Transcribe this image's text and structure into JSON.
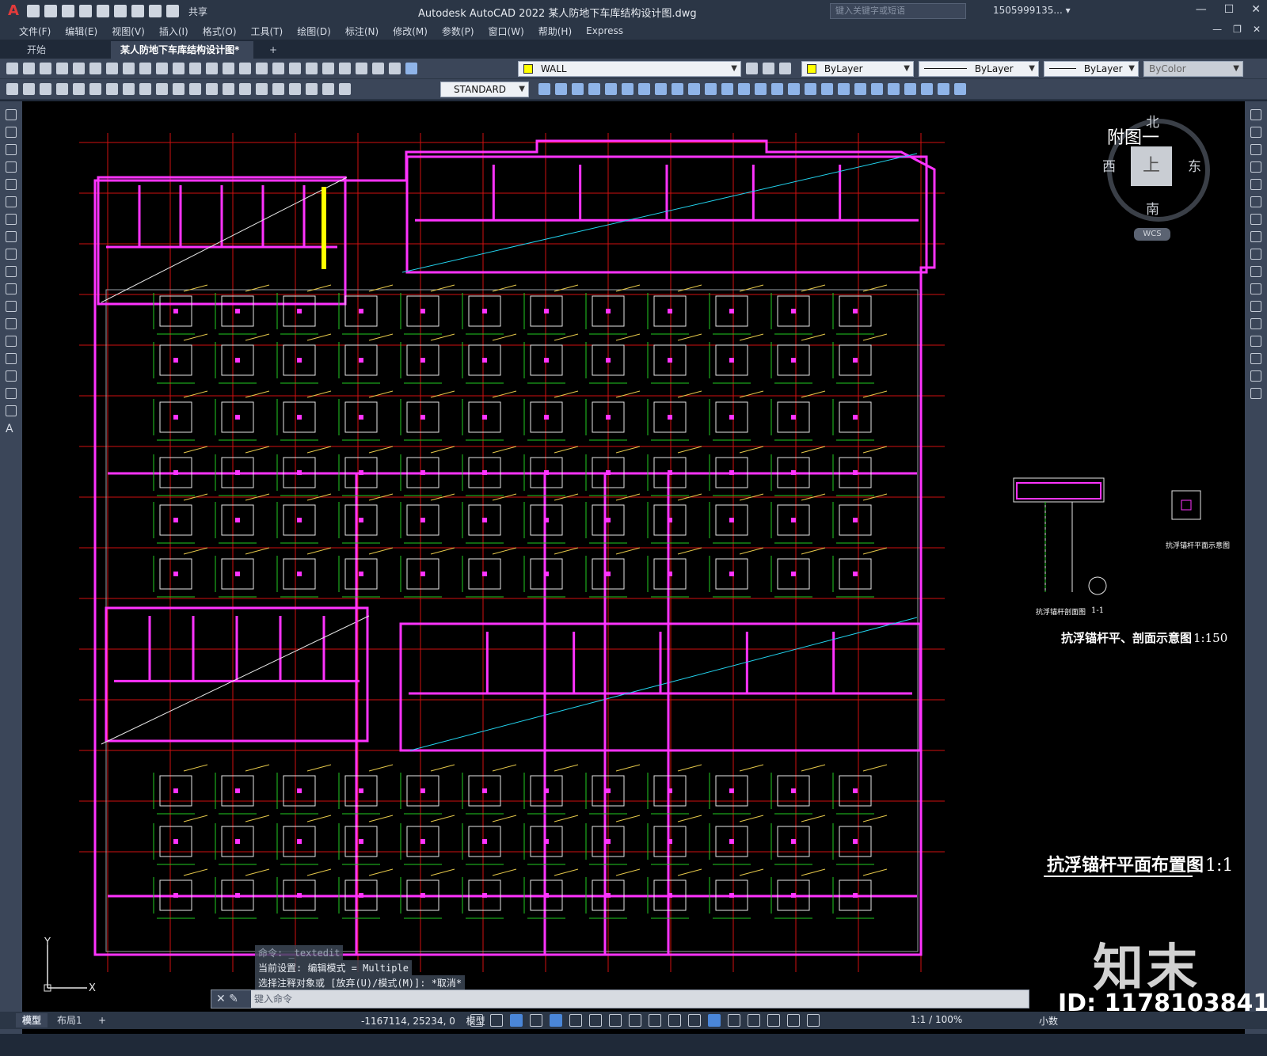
{
  "app": {
    "title": "Autodesk AutoCAD 2022    某人防地下车库结构设计图.dwg",
    "share_label": "共享",
    "search_placeholder": "键入关键字或短语",
    "user": "1505999135... ▾"
  },
  "menu": [
    "文件(F)",
    "编辑(E)",
    "视图(V)",
    "插入(I)",
    "格式(O)",
    "工具(T)",
    "绘图(D)",
    "标注(N)",
    "修改(M)",
    "参数(P)",
    "窗口(W)",
    "帮助(H)",
    "Express"
  ],
  "tabs": {
    "start": "开始",
    "doc": "某人防地下车库结构设计图*",
    "close": "✕",
    "add": "+"
  },
  "toolbar": {
    "layer": "WALL",
    "layer_color": "#ffff00",
    "color": "ByLayer",
    "linetype": "ByLayer",
    "lineweight": "ByLayer",
    "plotstyle": "ByColor",
    "textstyle": "STANDARD"
  },
  "viewcube": {
    "north": "北",
    "south": "南",
    "east": "东",
    "west": "西",
    "top": "上",
    "wcs": "WCS"
  },
  "drawing": {
    "fig_label": "附图一",
    "main_title": "抗浮锚杆平面布置图",
    "main_scale": "1:1",
    "section_title": "抗浮锚杆平、剖面示意图",
    "section_scale": "1:150",
    "section_sub1": "抗浮锚杆剖面图",
    "section_sub2": "1-1",
    "section_sub3": "抗浮锚杆平面示意图"
  },
  "command": {
    "history": [
      "命令:  _textedit",
      "当前设置: 编辑模式 = Multiple",
      "选择注释对象或 [放弃(U)/模式(M)]: *取消*"
    ],
    "prompt": "键入命令"
  },
  "status": {
    "model_tab": "模型",
    "layout_tab": "布局1",
    "add": "+",
    "coords": "-1167114, 25234, 0",
    "model": "模型",
    "scale": "1:1 / 100%",
    "units": "小数"
  },
  "watermark": {
    "brand": "知末",
    "id": "ID: 1178103841"
  }
}
